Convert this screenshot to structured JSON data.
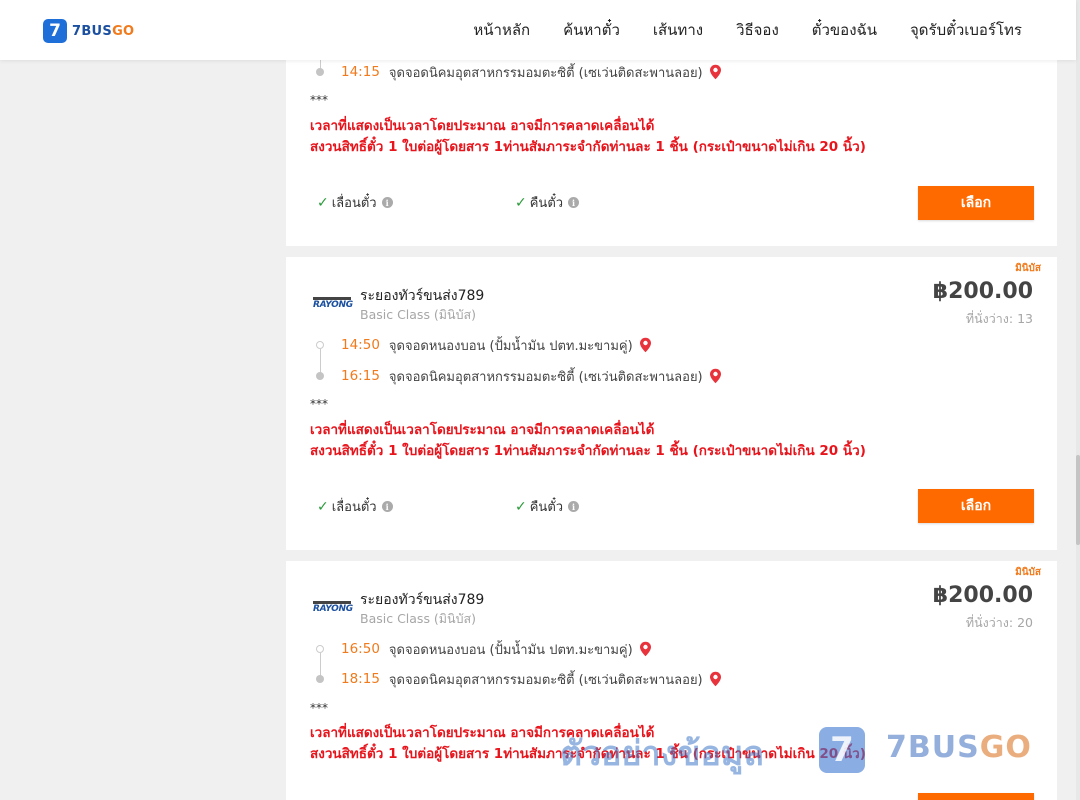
{
  "header": {
    "logo_mark": "7",
    "logo_text_main": "7BUS",
    "logo_text_accent": "GO",
    "nav": [
      "หน้าหลัก",
      "ค้นหาตั๋ว",
      "เส้นทาง",
      "วิธีจอง",
      "ตั๋วของฉัน",
      "จุดรับตั๋วเบอร์โทร"
    ]
  },
  "cards": [
    {
      "stops": [
        {
          "time": "14:15",
          "place": "จุดจอดนิคมอุตสาหกรรมอมตะซิตี้ (เซเว่นติดสะพานลอย)"
        }
      ],
      "stars": "***",
      "note_1": "เวลาที่แสดงเป็นเวลาโดยประมาณ อาจมีการคลาดเคลื่อนได้",
      "note_2": "สงวนสิทธิ์ตั๋ว 1 ใบต่อผู้โดยสาร 1ท่านสัมภาระจำกัดท่านละ 1 ชิ้น (กระเป๋าขนาดไม่เกิน 20 นิ้ว)",
      "feature_1": "เลื่อนตั๋ว",
      "feature_2": "คืนตั๋ว",
      "button": "เลือก"
    },
    {
      "tag": "มินิบัส",
      "operator_logo": "RAYONG",
      "operator": "ระยองทัวร์ขนส่ง789",
      "class": "Basic Class (มินิบัส)",
      "price": "฿200.00",
      "seats": "ที่นั่งว่าง: 13",
      "stops": [
        {
          "time": "14:50",
          "place": "จุดจอดหนองบอน (ปั้มน้ำมัน ปตท.มะขามคู่)"
        },
        {
          "time": "16:15",
          "place": "จุดจอดนิคมอุตสาหกรรมอมตะซิตี้ (เซเว่นติดสะพานลอย)"
        }
      ],
      "stars": "***",
      "note_1": "เวลาที่แสดงเป็นเวลาโดยประมาณ อาจมีการคลาดเคลื่อนได้",
      "note_2": "สงวนสิทธิ์ตั๋ว 1 ใบต่อผู้โดยสาร 1ท่านสัมภาระจำกัดท่านละ 1 ชิ้น (กระเป๋าขนาดไม่เกิน 20 นิ้ว)",
      "feature_1": "เลื่อนตั๋ว",
      "feature_2": "คืนตั๋ว",
      "button": "เลือก"
    },
    {
      "tag": "มินิบัส",
      "operator_logo": "RAYONG",
      "operator": "ระยองทัวร์ขนส่ง789",
      "class": "Basic Class (มินิบัส)",
      "price": "฿200.00",
      "seats": "ที่นั่งว่าง: 20",
      "stops": [
        {
          "time": "16:50",
          "place": "จุดจอดหนองบอน (ปั้มน้ำมัน ปตท.มะขามคู่)"
        },
        {
          "time": "18:15",
          "place": "จุดจอดนิคมอุตสาหกรรมอมตะซิตี้ (เซเว่นติดสะพานลอย)"
        }
      ],
      "stars": "***",
      "note_1": "เวลาที่แสดงเป็นเวลาโดยประมาณ อาจมีการคลาดเคลื่อนได้",
      "note_2": "สงวนสิทธิ์ตั๋ว 1 ใบต่อผู้โดยสาร 1ท่านสัมภาระจำกัดท่านละ 1 ชิ้น (กระเป๋าขนาดไม่เกิน 20 นิ้ว)"
    }
  ],
  "watermark": {
    "text": "ตัวอย่างข้อมูล",
    "mark": "7",
    "name_main": "7BUS",
    "name_accent": "GO"
  },
  "colors": {
    "accent": "#ff6a00",
    "time": "#f07a1c",
    "note": "#e8141c",
    "brand_blue": "#1f6fd8"
  }
}
